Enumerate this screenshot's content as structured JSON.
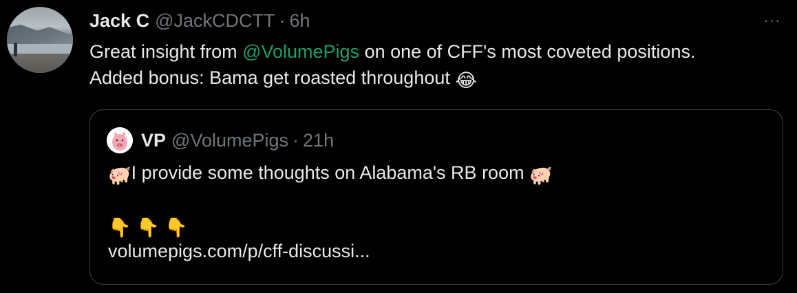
{
  "tweet": {
    "author_name": "Jack C",
    "author_handle": "@JackCDCTT",
    "separator": "·",
    "time": "6h",
    "more_label": "···",
    "text_part1": "Great insight from ",
    "mention": "@VolumePigs",
    "text_part2": " on one of CFF's most coveted positions.",
    "text_line2": "Added bonus: Bama get roasted throughout ",
    "emoji_laugh": "😂"
  },
  "quoted": {
    "author_name": "VP",
    "author_handle": "@VolumePigs",
    "separator": "·",
    "time": "21h",
    "line1_emoji_start": "🐖",
    "line1_text": "I provide some thoughts on Alabama's RB room ",
    "line1_emoji_end": "🐖",
    "pointing_emojis": [
      "👇",
      "👇",
      "👇"
    ],
    "link": "volumepigs.com/p/cff-discussi..."
  },
  "colors": {
    "background": "#000000",
    "text": "#e7e9ea",
    "muted": "#71767b",
    "mention": "#1d9e6a",
    "border": "#3e4144"
  }
}
